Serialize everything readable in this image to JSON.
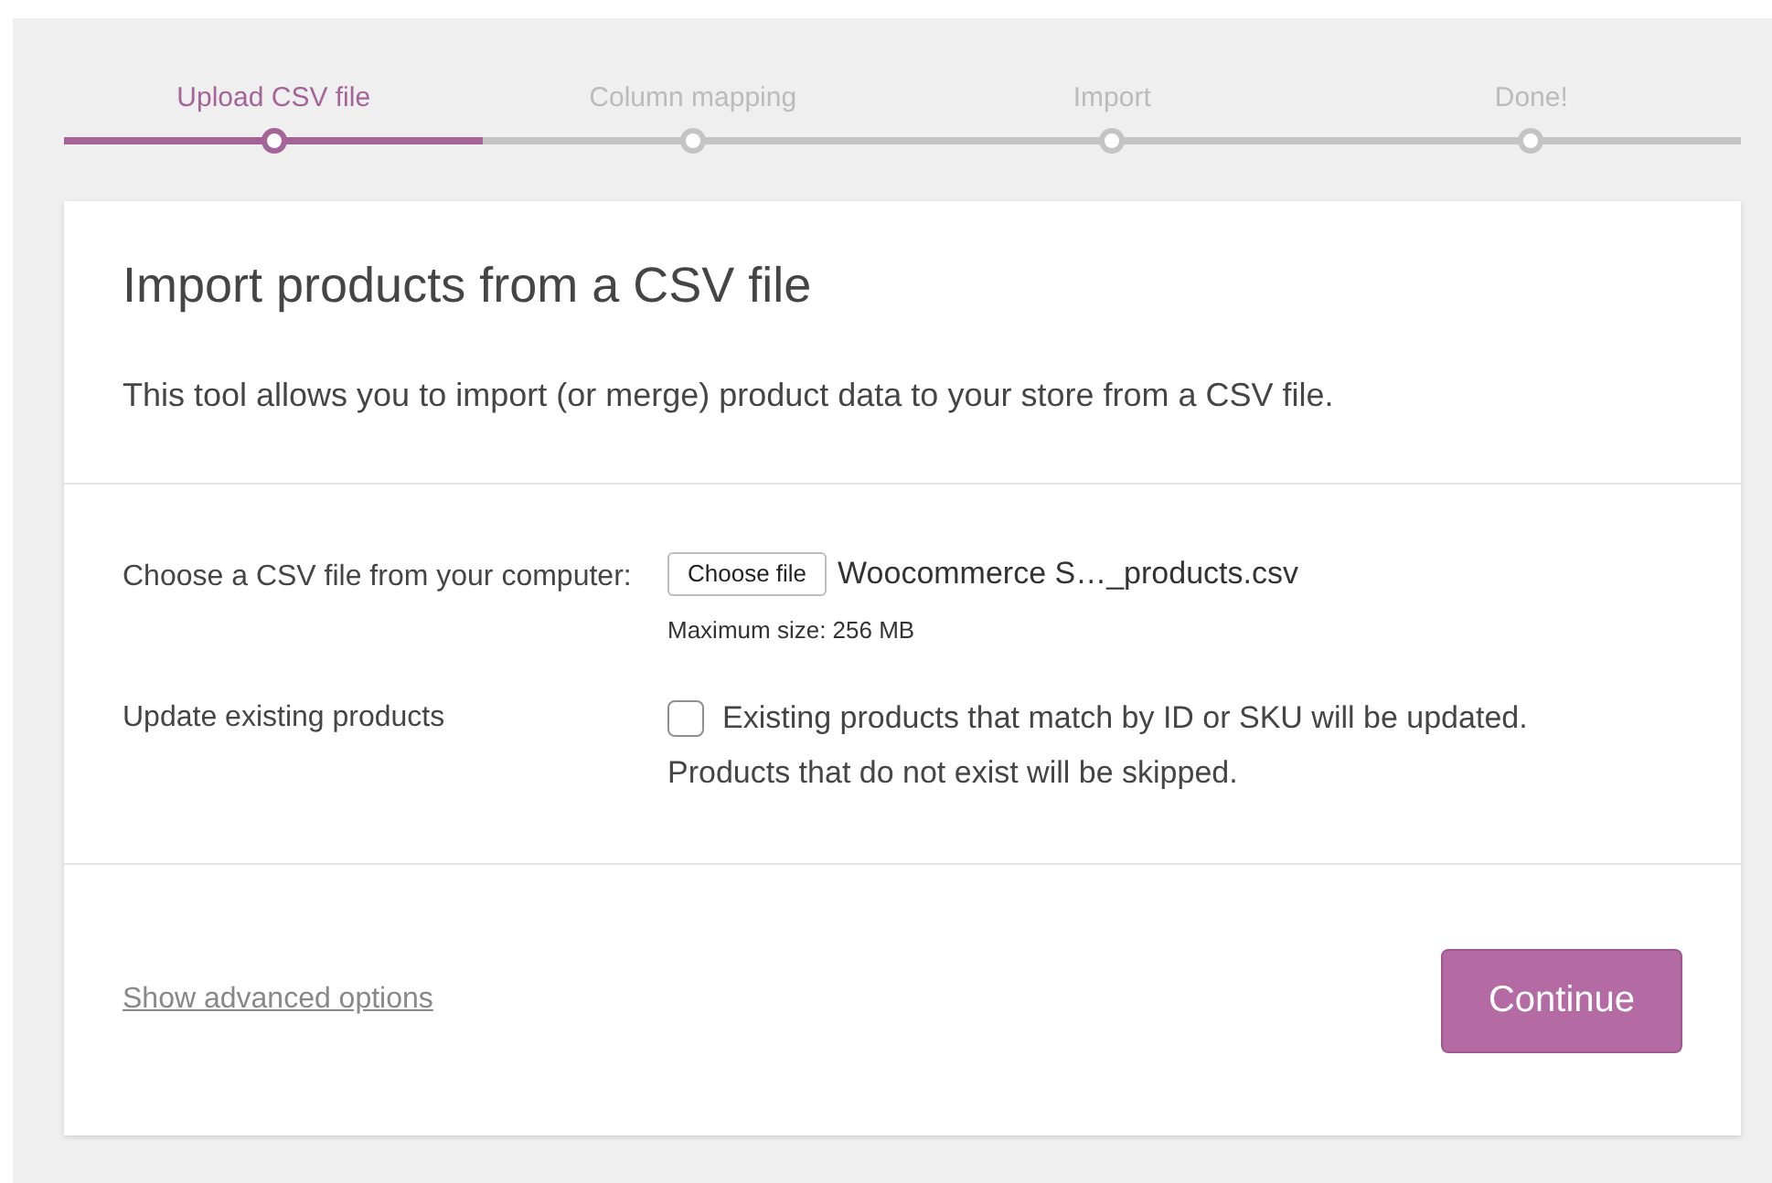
{
  "steps": [
    {
      "label": "Upload CSV file",
      "selected": true
    },
    {
      "label": "Column mapping",
      "selected": false
    },
    {
      "label": "Import",
      "selected": false
    },
    {
      "label": "Done!",
      "selected": false
    }
  ],
  "card": {
    "title": "Import products from a CSV file",
    "description": "This tool allows you to import (or merge) product data to your store from a CSV file.",
    "file_row": {
      "label": "Choose a CSV file from your computer:",
      "button": "Choose file",
      "file_name": "Woocommerce S…_products.csv",
      "hint": "Maximum size: 256 MB"
    },
    "update_row": {
      "label": "Update existing products",
      "checked": false,
      "checkbox_label": "Existing products that match by ID or SKU will be updated.",
      "note": "Products that do not exist will be skipped."
    },
    "advanced_link": "Show advanced options",
    "continue_button": "Continue"
  }
}
